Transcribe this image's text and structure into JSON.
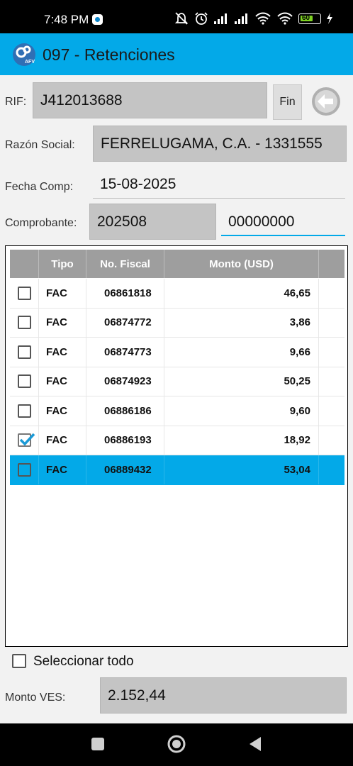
{
  "status_bar": {
    "time": "7:48 PM",
    "battery": "60",
    "icons": [
      "app-notification-icon",
      "mute-icon",
      "alarm-icon",
      "signal-icon",
      "signal-icon",
      "wifi-icon",
      "wifi-icon",
      "battery-icon",
      "charging-icon"
    ]
  },
  "app_bar": {
    "title": "097 - Retenciones",
    "logo_text": "AFV",
    "color": "#03a9e8"
  },
  "form": {
    "rif_label": "RIF:",
    "rif_value": "J412013688",
    "fin_button": "Fin",
    "razon_label": "Razón Social:",
    "razon_value": "FERRELUGAMA, C.A. - 1331555",
    "fecha_label": "Fecha Comp:",
    "fecha_value": "15-08-2025",
    "comprobante_label": "Comprobante:",
    "comprobante_value_1": "202508",
    "comprobante_value_2": "00000000"
  },
  "table": {
    "columns": [
      "",
      "Tipo",
      "No. Fiscal",
      "Monto (USD)",
      ""
    ],
    "rows": [
      {
        "checked": false,
        "tipo": "FAC",
        "no_fiscal": "06861818",
        "monto": "46,65",
        "selected": false
      },
      {
        "checked": false,
        "tipo": "FAC",
        "no_fiscal": "06874772",
        "monto": "3,86",
        "selected": false
      },
      {
        "checked": false,
        "tipo": "FAC",
        "no_fiscal": "06874773",
        "monto": "9,66",
        "selected": false
      },
      {
        "checked": false,
        "tipo": "FAC",
        "no_fiscal": "06874923",
        "monto": "50,25",
        "selected": false
      },
      {
        "checked": false,
        "tipo": "FAC",
        "no_fiscal": "06886186",
        "monto": "9,60",
        "selected": false
      },
      {
        "checked": true,
        "tipo": "FAC",
        "no_fiscal": "06886193",
        "monto": "18,92",
        "selected": false
      },
      {
        "checked": false,
        "tipo": "FAC",
        "no_fiscal": "06889432",
        "monto": "53,04",
        "selected": true
      }
    ]
  },
  "footer": {
    "select_all_label": "Seleccionar todo",
    "monto_ves_label": "Monto VES:",
    "monto_ves_value": "2.152,44"
  },
  "nav_bar": {
    "icons": [
      "recents-square-icon",
      "home-circle-icon",
      "back-triangle-icon"
    ]
  }
}
